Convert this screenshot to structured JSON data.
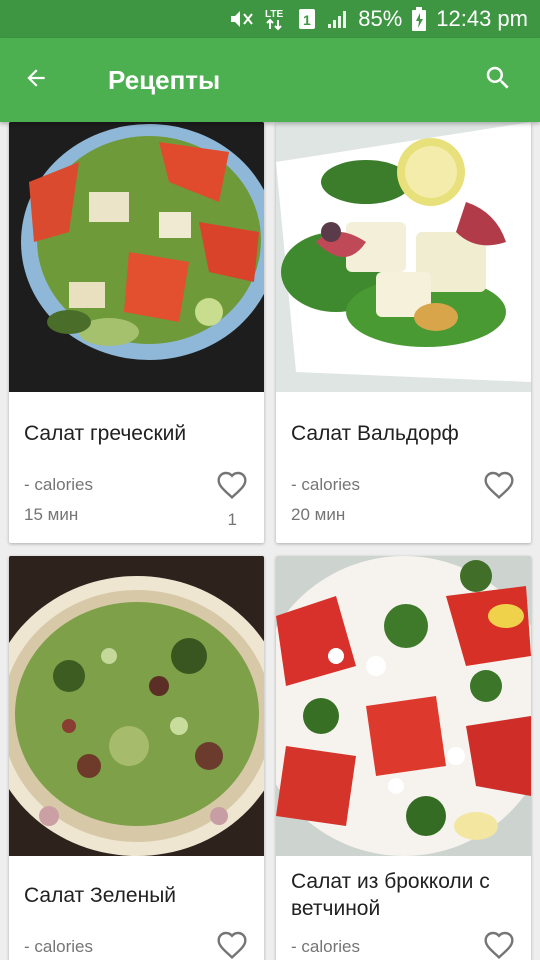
{
  "status_bar": {
    "battery_percent": "85%",
    "time": "12:43 pm",
    "icons": [
      "mute-icon",
      "lte-icon",
      "sim-1-icon",
      "signal-icon",
      "battery-charging-icon"
    ]
  },
  "app_bar": {
    "title": "Рецепты",
    "back_icon": "arrow-back-icon",
    "search_icon": "search-icon"
  },
  "recipes": [
    {
      "title": "Салат греческий",
      "calories": "- calories",
      "time": "15 мин",
      "favorites": "1",
      "favorite_icon": "heart-outline-icon"
    },
    {
      "title": "Салат Вальдорф",
      "calories": "- calories",
      "time": "20 мин",
      "favorites": "",
      "favorite_icon": "heart-outline-icon"
    },
    {
      "title": "Салат Зеленый",
      "calories": "- calories",
      "time": "",
      "favorites": "",
      "favorite_icon": "heart-outline-icon"
    },
    {
      "title": "Салат из брокколи с ветчиной",
      "calories": "- calories",
      "time": "",
      "favorites": "",
      "favorite_icon": "heart-outline-icon"
    }
  ],
  "colors": {
    "status_bar": "#3e9643",
    "app_bar": "#4caf50",
    "background": "#eeeeee",
    "secondary_text": "#757575"
  }
}
